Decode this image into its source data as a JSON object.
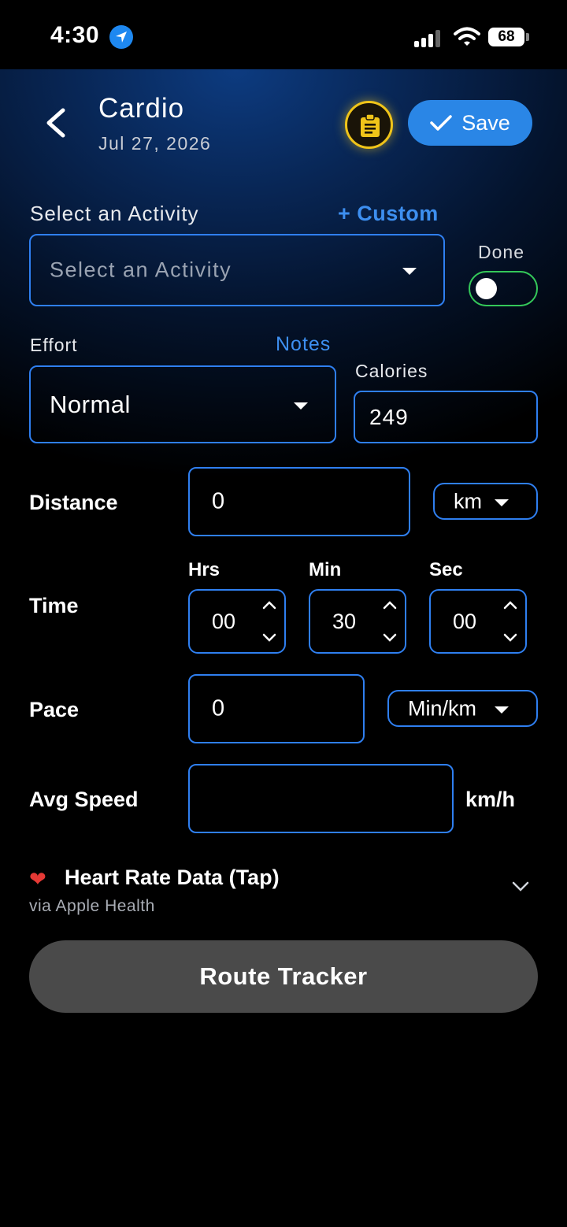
{
  "status": {
    "time": "4:30",
    "battery": "68",
    "icons": [
      "location-arrow-icon",
      "cellular-signal-icon",
      "wifi-icon",
      "battery-icon"
    ]
  },
  "header": {
    "title": "Cardio",
    "date": "Jul 27, 2026",
    "save_label": "Save",
    "icons": [
      "chevron-left-icon",
      "clipboard-icon",
      "checkmark-icon"
    ]
  },
  "activity": {
    "label": "Select an Activity",
    "custom_link": "+ Custom",
    "placeholder": "Select an Activity",
    "done_label": "Done",
    "done_on": false
  },
  "effort": {
    "label": "Effort",
    "notes_link": "Notes",
    "value": "Normal"
  },
  "calories": {
    "label": "Calories",
    "value": "249"
  },
  "distance": {
    "label": "Distance",
    "value": "0",
    "unit": "km"
  },
  "time": {
    "label": "Time",
    "hrs_label": "Hrs",
    "min_label": "Min",
    "sec_label": "Sec",
    "hrs": "00",
    "min": "30",
    "sec": "00"
  },
  "pace": {
    "label": "Pace",
    "value": "0",
    "unit": "Min/km"
  },
  "avg_speed": {
    "label": "Avg Speed",
    "value": "",
    "unit": "km/h"
  },
  "heart_rate": {
    "icon": "❤",
    "title": "Heart Rate Data (Tap)",
    "subtitle": "via Apple Health"
  },
  "route_tracker": {
    "label": "Route Tracker"
  },
  "colors": {
    "accent_blue": "#2a86e6",
    "field_border": "#2f7ff0",
    "toggle_border": "#34c759",
    "notes_icon_ring": "#f0c419",
    "route_button": "#4a4a4a"
  }
}
